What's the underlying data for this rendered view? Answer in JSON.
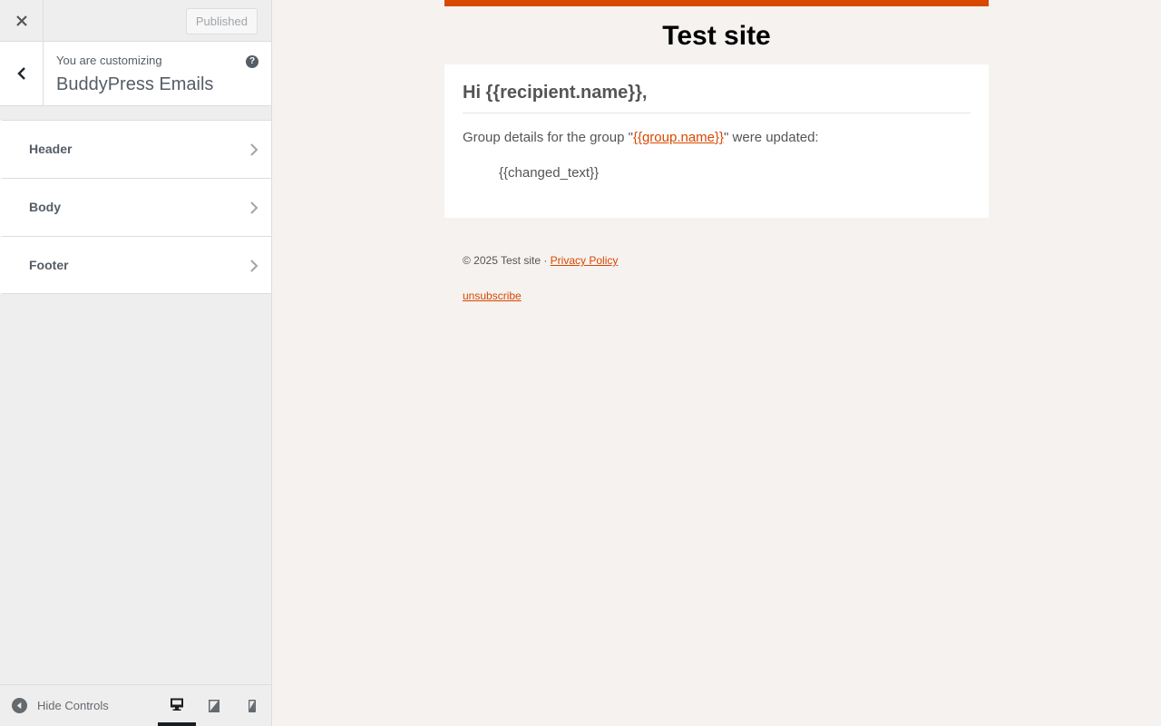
{
  "topbar": {
    "close_label": "Close",
    "publish_label": "Published"
  },
  "customizing": {
    "label": "You are customizing",
    "title": "BuddyPress Emails",
    "help_glyph": "?"
  },
  "sections": [
    {
      "label": "Header"
    },
    {
      "label": "Body"
    },
    {
      "label": "Footer"
    }
  ],
  "footer_bar": {
    "hide_label": "Hide Controls",
    "devices": [
      "desktop",
      "tablet",
      "mobile"
    ],
    "active_device": "desktop"
  },
  "preview": {
    "accent_color": "#d84800",
    "site_title": "Test site",
    "greeting": "Hi {{recipient.name}},",
    "body_prefix": "Group details for the group \"",
    "body_link": "{{group.name}}",
    "body_suffix": "\" were updated:",
    "changed_text": "{{changed_text}}",
    "footer_copyright": "© 2025 Test site · ",
    "privacy_link": "Privacy Policy",
    "unsubscribe_link": "unsubscribe"
  }
}
